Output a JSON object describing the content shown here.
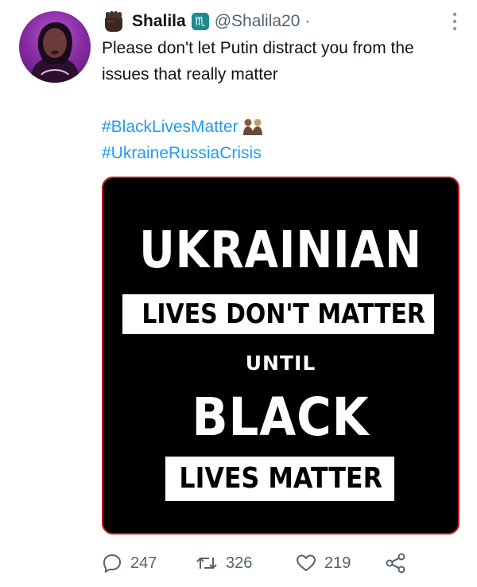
{
  "tweet": {
    "author": {
      "display_name": "Shalila",
      "handle": "@Shalila20",
      "separator": "·"
    },
    "text": "Please don't let Putin distract you from the issues that really matter",
    "hashtags": [
      "#BlackLivesMatter",
      "#UkraineRussiaCrisis"
    ],
    "media": {
      "line1": "UKRAINIAN",
      "line2": "LIVES DON'T MATTER",
      "line3": "UNTIL",
      "line4": "BLACK",
      "line5": "LIVES MATTER"
    },
    "stats": {
      "replies": "247",
      "retweets": "326",
      "likes": "219"
    }
  },
  "colors": {
    "link": "#1d9bf0",
    "muted": "#536471",
    "media_border": "#b81d1d",
    "zodiac_badge": "#1d8a8f"
  },
  "icons": {
    "fist": "raised-fist-icon",
    "zodiac": "scorpio-icon",
    "more": "more-vertical-icon",
    "hands": "holding-hands-icon",
    "reply": "reply-icon",
    "retweet": "retweet-icon",
    "like": "heart-icon",
    "share": "share-icon"
  }
}
